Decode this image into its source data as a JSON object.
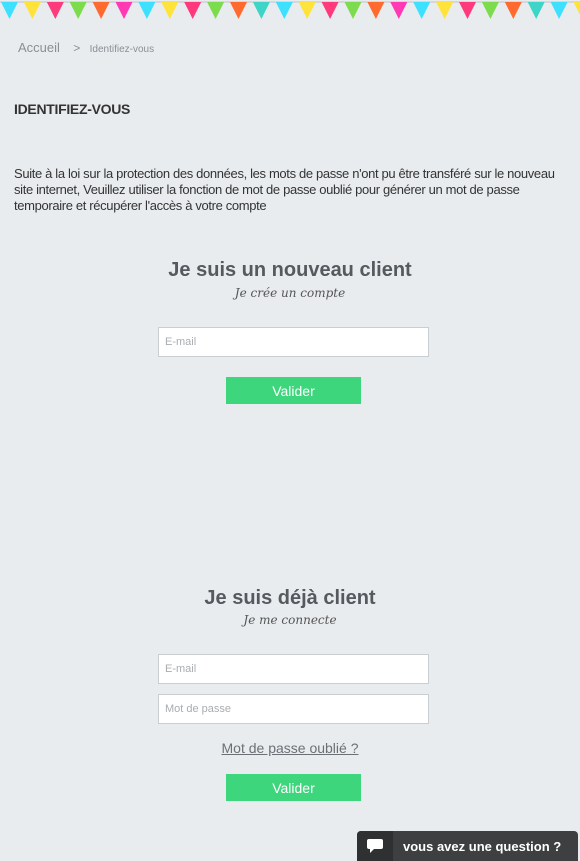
{
  "banner": {
    "flag_colors": [
      "#3ee0ff",
      "#ffe23a",
      "#ff3a7c",
      "#7cdc4e",
      "#ff6a2e",
      "#ff3ab2",
      "#3ee0ff",
      "#ffe23a",
      "#ff3a7c",
      "#7cdc4e",
      "#ff6a2e",
      "#3ed4c8"
    ]
  },
  "breadcrumb": {
    "home": "Accueil",
    "separator": ">",
    "current": "Identifiez-vous"
  },
  "page": {
    "title": "IDENTIFIEZ-VOUS",
    "notice": "Suite à la loi sur la protection des données, les mots de passe n'ont pu être transféré sur le nouveau site internet, Veuillez utiliser la fonction de mot de passe oublié pour générer un mot de passe temporaire et récupérer l'accès à votre compte"
  },
  "new_client": {
    "title": "Je suis un nouveau client",
    "subtitle": "Je crée un compte",
    "email_placeholder": "E-mail",
    "email_value": "",
    "submit_label": "Valider"
  },
  "existing_client": {
    "title": "Je suis déjà client",
    "subtitle": "Je me connecte",
    "email_placeholder": "E-mail",
    "password_placeholder": "Mot de passe",
    "forgot_label": "Mot de passe oublié ?",
    "submit_label": "Valider"
  },
  "chat": {
    "label": "vous avez une question ?",
    "icon": "chat-bubble-icon"
  },
  "colors": {
    "background": "#e9ecef",
    "button": "#3ed67c",
    "chat_bg": "#3d3f41"
  }
}
